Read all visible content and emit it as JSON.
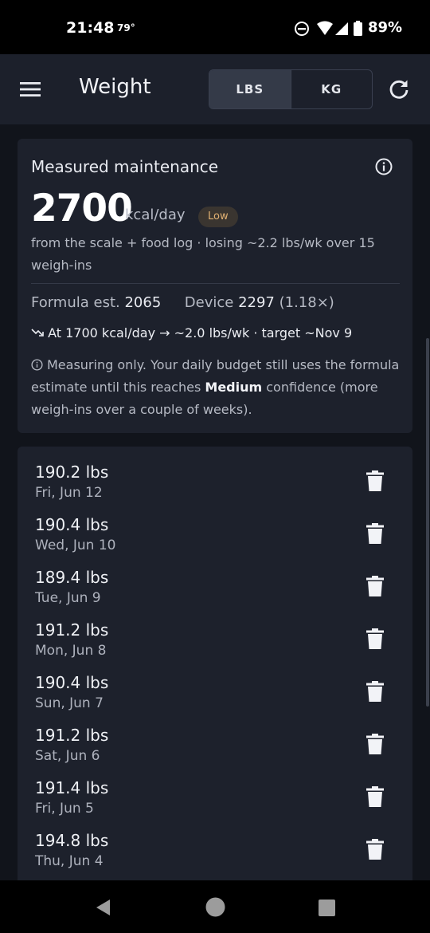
{
  "status_bar": {
    "time": "21:48",
    "temperature": "79°",
    "battery": "89%",
    "icons": [
      "do-not-disturb-icon",
      "wifi-icon",
      "signal-icon",
      "battery-icon"
    ]
  },
  "app_bar": {
    "title": "Weight",
    "units": [
      "LBS",
      "KG"
    ],
    "selected_unit": "LBS"
  },
  "maintenance": {
    "title": "Measured maintenance",
    "value": "2700",
    "unit": "kcal/day",
    "confidence": "Low",
    "subtitle": "from the scale + food log · losing ~2.2 lbs/wk over 15 weigh-ins",
    "formula_label": "Formula est.",
    "formula_value": "2065",
    "device_label": "Device",
    "device_value": "2297",
    "device_ratio": "(1.18×)",
    "trend": "At 1700 kcal/day → ~2.0 lbs/wk · target ~Nov 9",
    "note_before": "Measuring only. Your daily budget still uses the formula estimate until this reaches ",
    "note_bold": "Medium",
    "note_after": " confidence (more weigh-ins over a couple of weeks)."
  },
  "entries": [
    {
      "weight": "190.2 lbs",
      "date": "Fri, Jun 12"
    },
    {
      "weight": "190.4 lbs",
      "date": "Wed, Jun 10"
    },
    {
      "weight": "189.4 lbs",
      "date": "Tue, Jun 9"
    },
    {
      "weight": "191.2 lbs",
      "date": "Mon, Jun 8"
    },
    {
      "weight": "190.4 lbs",
      "date": "Sun, Jun 7"
    },
    {
      "weight": "191.2 lbs",
      "date": "Sat, Jun 6"
    },
    {
      "weight": "191.4 lbs",
      "date": "Fri, Jun 5"
    },
    {
      "weight": "194.8 lbs",
      "date": "Thu, Jun 4"
    }
  ],
  "colors": {
    "background": "#11141b",
    "card": "#1d212c",
    "app_bar": "#1c202b",
    "badge_text": "#e0b072"
  }
}
